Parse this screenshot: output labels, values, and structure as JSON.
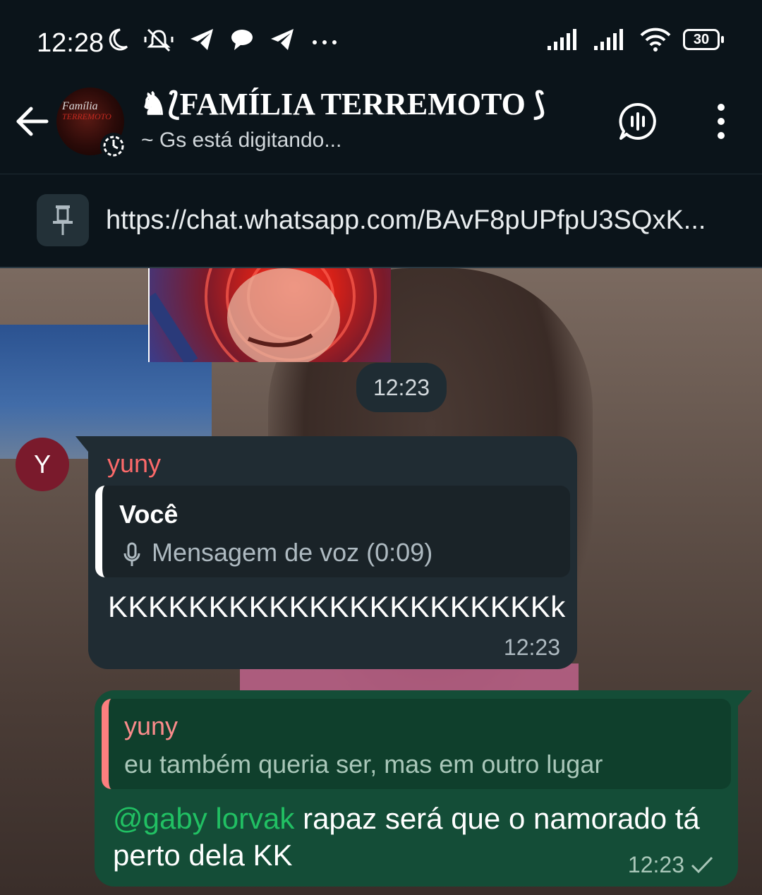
{
  "status_bar": {
    "time": "12:28",
    "battery": "30",
    "icons_left": [
      "moon-icon",
      "muted-icon",
      "telegram-icon",
      "chat-bubble-icon",
      "telegram-icon",
      "more-icon"
    ],
    "icons_right": [
      "signal-icon",
      "signal-icon",
      "wifi-icon",
      "battery-icon"
    ]
  },
  "header": {
    "title": "♞⟅FAMÍLIA TERREMOTO ⟆",
    "subtitle": "~ Gs está digitando...",
    "avatar_logo_line1": "Família",
    "avatar_logo_line2": "TERREMOTO"
  },
  "pinned": {
    "text": "https://chat.whatsapp.com/BAvF8pUPfpU3SQxK..."
  },
  "chat": {
    "time_chip": "12:23",
    "incoming": {
      "avatar_letter": "Y",
      "sender": "yuny",
      "quote_author": "Você",
      "quote_text": "Mensagem de voz (0:09)",
      "text": "KKKKKKKKKKKKKKKKKKKKKKk",
      "time": "12:23"
    },
    "outgoing": {
      "quote_author": "yuny",
      "quote_text": "eu também queria ser, mas em outro lugar",
      "mention": "@gaby lorvak",
      "text": " rapaz será que o namorado tá perto dela KK",
      "time": "12:23"
    }
  },
  "colors": {
    "background": "#0b141a",
    "incoming_bubble": "#202c33",
    "outgoing_bubble": "#144d37",
    "mention": "#21c063",
    "sender_name": "#fc6a6a"
  }
}
